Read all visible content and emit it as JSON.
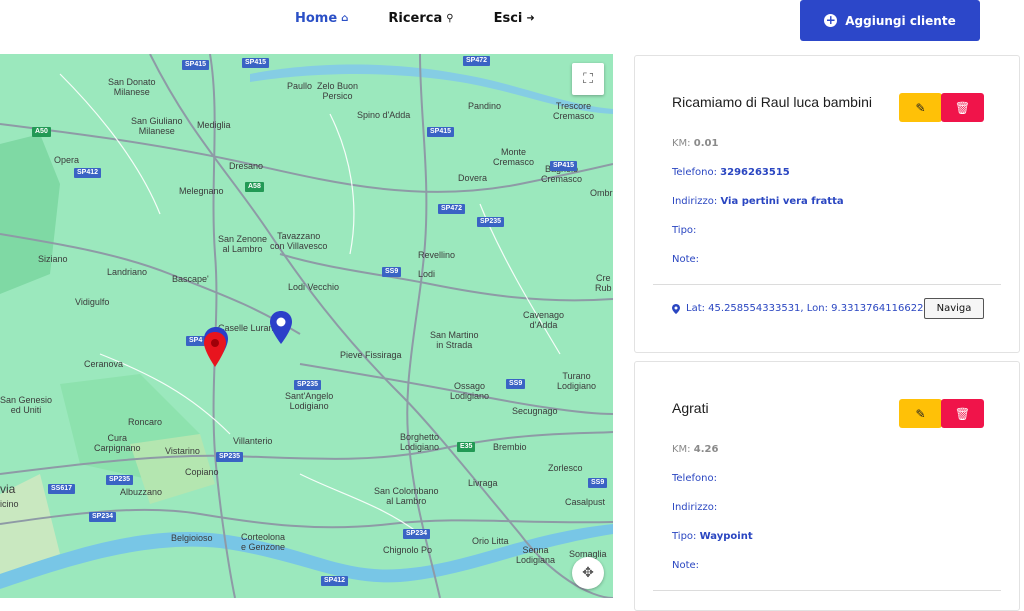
{
  "nav": {
    "home": "Home",
    "search": "Ricerca",
    "exit": "Esci",
    "add_client": "Aggiungi cliente"
  },
  "colors": {
    "accent": "#2c47c9",
    "edit": "#ffc107",
    "delete": "#f0144a",
    "map_bg": "#9be8bd"
  },
  "map": {
    "places": [
      "San Donato\nMilanese",
      "Paullo",
      "Zelo Buon\nPersico",
      "Spino d'Adda",
      "Pandino",
      "Trescore\nCremasco",
      "San Giuliano\nMilanese",
      "Mediglia",
      "Opera",
      "Dresano",
      "Monte\nCremasco",
      "Dovera",
      "Bagnolo\nCremasco",
      "Ombri",
      "Melegnano",
      "San Zenone\nal Lambro",
      "Tavazzano\ncon Villavesco",
      "Revellino",
      "Siziano",
      "Landriano",
      "Bascape'",
      "Lodi",
      "Cre\nRub",
      "Vidigulfo",
      "Lodi Vecchio",
      "Cavenago\nd'Adda",
      "Caselle Lurani",
      "San Martino\nin Strada",
      "Ceranova",
      "Pieve Fissiraga",
      "Turano\nLodigiano",
      "San Genesio\ned Uniti",
      "Sant'Angelo\nLodigiano",
      "Ossago\nLodigiano",
      "Secugnago",
      "Roncaro",
      "Cura\nCarpignano",
      "Vistarino",
      "Villanterio",
      "Borghetto\nLodigiano",
      "Brembio",
      "Copiano",
      "Zorlesco",
      "via",
      "Albuzzano",
      "Livraga",
      "icino",
      "San Colombano\nal Lambro",
      "Casalpust",
      "Belgioioso",
      "Corteolona\ne Genzone",
      "Chignolo Po",
      "Orio Litta",
      "Senna\nLodigiana",
      "Somaglia"
    ],
    "roads": [
      "SP415",
      "SP415",
      "SP472",
      "A50",
      "SP415",
      "SP412",
      "SP415",
      "A58",
      "SP472",
      "SP235",
      "SS9",
      "SP4",
      "SP235",
      "SS9",
      "SP235",
      "E35",
      "SP235",
      "SS617",
      "SP234",
      "SP234",
      "SP412",
      "SS9"
    ]
  },
  "cards": [
    {
      "title": "Ricamiamo di Raul luca bambini",
      "km_label": "KM:",
      "km_value": "0.01",
      "phone_label": "Telefono:",
      "phone_value": "3296263515",
      "address_label": "Indirizzo:",
      "address_value": "Via pertini vera fratta",
      "type_label": "Tipo:",
      "type_value": "",
      "notes_label": "Note:",
      "notes_value": "",
      "coords": "Lat: 45.258554333531, Lon: 9.3313764116622",
      "navigate": "Naviga"
    },
    {
      "title": "Agrati",
      "km_label": "KM:",
      "km_value": "4.26",
      "phone_label": "Telefono:",
      "phone_value": "",
      "address_label": "Indirizzo:",
      "address_value": "",
      "type_label": "Tipo:",
      "type_value": "Waypoint",
      "notes_label": "Note:",
      "notes_value": ""
    }
  ]
}
